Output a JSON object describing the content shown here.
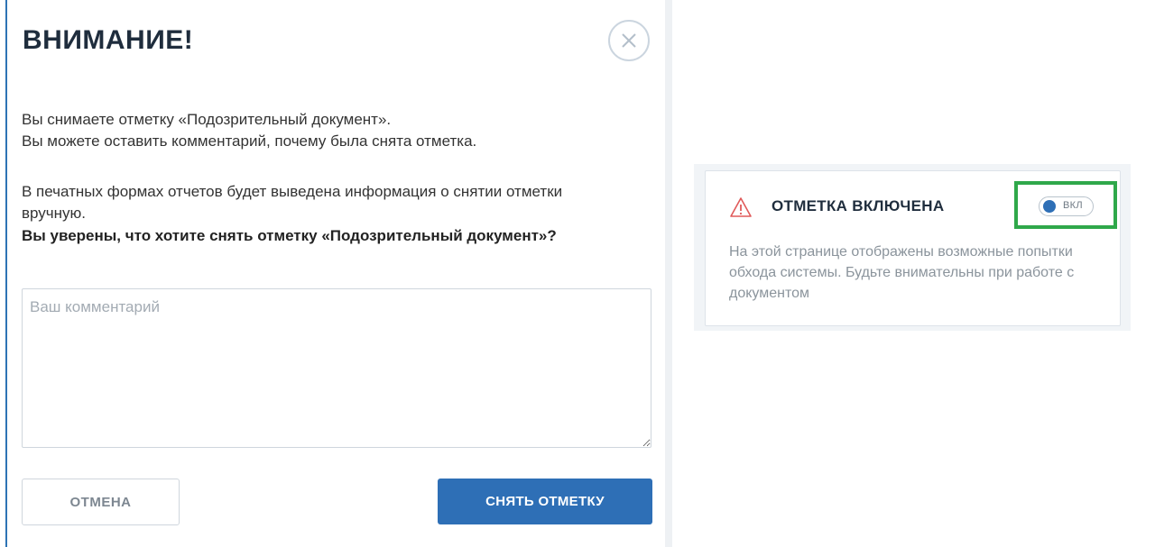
{
  "dialog": {
    "title": "ВНИМАНИЕ!",
    "close_icon": "close-icon",
    "paragraph_1": "Вы снимаете отметку «Подозрительный документ». Вы можете оставить комментарий, почему была снята отметка.",
    "paragraph_1_line_1": "Вы снимаете отметку «Подозрительный документ».",
    "paragraph_1_line_2": "Вы можете оставить комментарий, почему была снята отметка.",
    "paragraph_2": "В печатных формах отчетов будет выведена информация о снятии отметки вручную.",
    "question": "Вы уверены, что хотите снять отметку «Подозрительный документ»?",
    "comment": {
      "value": "",
      "placeholder": "Ваш комментарий"
    },
    "cancel_label": "ОТМЕНА",
    "confirm_label": "СНЯТЬ ОТМЕТКУ"
  },
  "notice": {
    "icon": "warning-triangle-icon",
    "title": "ОТМЕТКА ВКЛЮЧЕНА",
    "text": "На этой странице отображены возможные попытки обхода системы. Будьте внимательны при работе с документом",
    "toggle": {
      "label": "ВКЛ",
      "on": true
    }
  },
  "colors": {
    "accent": "#2e6fb6",
    "highlight": "#2fa84a",
    "warning": "#e05a5a",
    "title": "#1f2d3d"
  }
}
